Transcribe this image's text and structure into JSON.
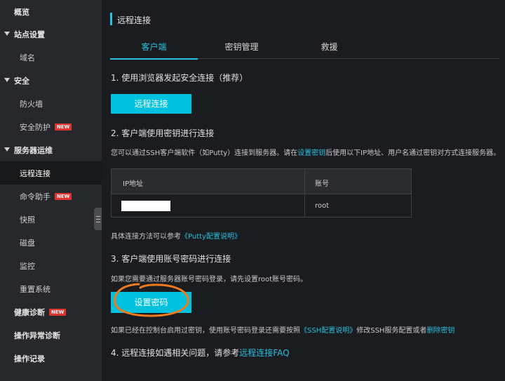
{
  "sidebar": {
    "overview": "概览",
    "site_settings": "站点设置",
    "domain": "域名",
    "security": "安全",
    "firewall": "防火墙",
    "security_protection": "安全防护",
    "server_ops": "服务器运维",
    "remote_connection": "远程连接",
    "command_assistant": "命令助手",
    "snapshot": "快照",
    "disk": "磁盘",
    "monitor": "监控",
    "reset_system": "重置系统",
    "health_diagnosis": "健康诊断",
    "exception_diagnosis": "操作异常诊断",
    "operation_log": "操作记录",
    "new_badge": "NEW"
  },
  "main": {
    "title": "远程连接",
    "tabs": [
      "客户端",
      "密钥管理",
      "救援"
    ],
    "step1": "1. 使用浏览器发起安全连接（推荐）",
    "btn_remote": "远程连接",
    "step2": "2. 客户端使用密钥进行连接",
    "step2_desc_a": "您可以通过SSH客户端软件（如Putty）连接到服务器。请在",
    "step2_desc_link": "设置密钥",
    "step2_desc_b": "后使用以下IP地址、用户名通过密钥对方式连接服务器。",
    "table": {
      "col_ip": "IP地址",
      "col_account": "账号",
      "account": "root"
    },
    "ref_a": "具体连接方法可以参考",
    "ref_link": "《Putty配置说明》",
    "step3": "3. 客户端使用账号密码进行连接",
    "step3_desc": "如果您需要通过服务器账号密码登录，请先设置root账号密码。",
    "btn_set_password": "设置密码",
    "note_a": "如果已经在控制台启用过密钥，使用账号密码登录还需要按照",
    "note_link1": "《SSH配置说明》",
    "note_b": "修改SSH服务配置或者",
    "note_link2": "删除密钥",
    "step4_a": "4. 远程连接如遇相关问题，请参考",
    "step4_link": "远程连接FAQ"
  },
  "colors": {
    "accent": "#00c1de",
    "annotation": "#f07a1e"
  }
}
